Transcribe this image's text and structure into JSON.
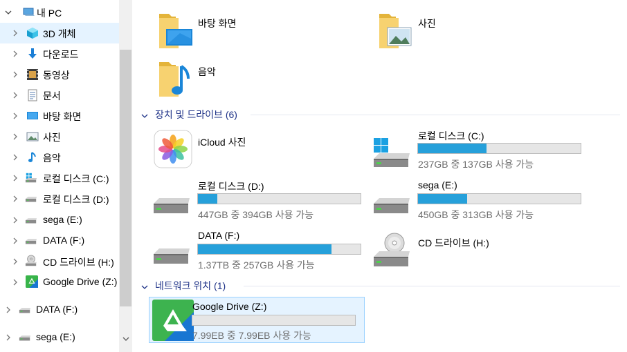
{
  "nav": {
    "root_label": "내 PC",
    "items": [
      {
        "label": "3D 개체",
        "icon": "3d-objects-icon"
      },
      {
        "label": "다운로드",
        "icon": "downloads-icon"
      },
      {
        "label": "동영상",
        "icon": "videos-icon"
      },
      {
        "label": "문서",
        "icon": "documents-icon"
      },
      {
        "label": "바탕 화면",
        "icon": "desktop-icon"
      },
      {
        "label": "사진",
        "icon": "pictures-icon"
      },
      {
        "label": "음악",
        "icon": "music-icon"
      },
      {
        "label": "로컬 디스크 (C:)",
        "icon": "windows-drive-icon"
      },
      {
        "label": "로컬 디스크 (D:)",
        "icon": "drive-icon"
      },
      {
        "label": "sega (E:)",
        "icon": "drive-icon"
      },
      {
        "label": "DATA (F:)",
        "icon": "drive-icon"
      },
      {
        "label": "CD 드라이브 (H:)",
        "icon": "cd-drive-icon"
      },
      {
        "label": "Google Drive (Z:)",
        "icon": "google-drive-icon"
      }
    ],
    "extra": [
      {
        "label": "DATA (F:)"
      },
      {
        "label": "sega (E:)"
      }
    ]
  },
  "folders": [
    {
      "label": "바탕 화면",
      "icon": "desktop-folder-icon"
    },
    {
      "label": "사진",
      "icon": "pictures-folder-icon"
    },
    {
      "label": "음악",
      "icon": "music-folder-icon"
    }
  ],
  "devices_group": {
    "title": "장치 및 드라이브 (6)"
  },
  "devices": [
    {
      "name": "iCloud 사진",
      "icon": "icloud-photos-icon"
    },
    {
      "name": "로컬 디스크 (C:)",
      "free": "237GB 중 137GB 사용 가능",
      "used_fraction": 0.42,
      "icon": "windows-drive-icon"
    },
    {
      "name": "로컬 디스크 (D:)",
      "free": "447GB 중 394GB 사용 가능",
      "used_fraction": 0.12,
      "icon": "drive-icon"
    },
    {
      "name": "sega (E:)",
      "free": "450GB 중 313GB 사용 가능",
      "used_fraction": 0.3,
      "icon": "drive-icon"
    },
    {
      "name": "DATA (F:)",
      "free": "1.37TB 중 257GB 사용 가능",
      "used_fraction": 0.82,
      "icon": "drive-icon"
    },
    {
      "name": "CD 드라이브 (H:)",
      "icon": "cd-drive-icon"
    }
  ],
  "network_group": {
    "title": "네트워크 위치 (1)"
  },
  "network": [
    {
      "name": "Google Drive (Z:)",
      "free": "7.99EB 중 7.99EB 사용 가능",
      "used_fraction": 0.0,
      "icon": "google-drive-icon"
    }
  ],
  "colors": {
    "selection": "#e5f3ff",
    "group_title": "#1e3287",
    "bar_fill": "#26a0da",
    "bar_track": "#e6e6e6",
    "sub_text": "#6d6d6d"
  }
}
